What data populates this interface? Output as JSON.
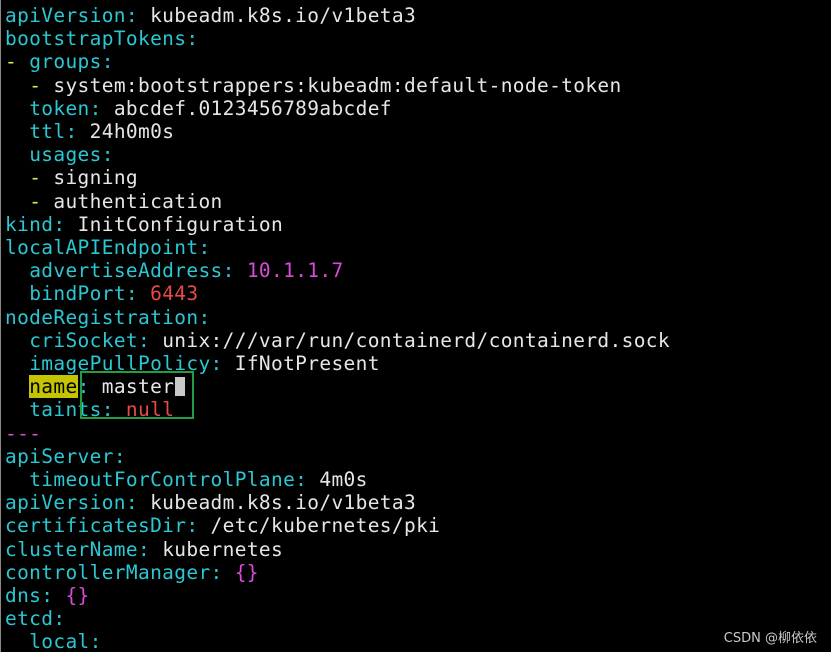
{
  "colors": {
    "background": "#000000",
    "key": "#2bc7d2",
    "list_dash": "#e8e84a",
    "value": "#e6e6e6",
    "number_value": "#d94bd9",
    "port_value": "#e84a4a",
    "search_highlight": "#c4c400",
    "selection_box": "#1f9e44"
  },
  "lines": [
    {
      "key": "apiVersion",
      "value": "kubeadm.k8s.io/v1beta3"
    },
    {
      "key": "bootstrapTokens"
    },
    {
      "dash": "- ",
      "key": "groups"
    },
    {
      "indent": "  ",
      "dash": "- ",
      "value": "system:bootstrappers:kubeadm:default-node-token"
    },
    {
      "indent": "  ",
      "key": "token",
      "value": "abcdef.0123456789abcdef"
    },
    {
      "indent": "  ",
      "key": "ttl",
      "value": "24h0m0s"
    },
    {
      "indent": "  ",
      "key": "usages"
    },
    {
      "indent": "  ",
      "dash": "- ",
      "value": "signing"
    },
    {
      "indent": "  ",
      "dash": "- ",
      "value": "authentication"
    },
    {
      "key": "kind",
      "value": "InitConfiguration"
    },
    {
      "key": "localAPIEndpoint"
    },
    {
      "indent": "  ",
      "key": "advertiseAddress",
      "value": "10.1.1.7"
    },
    {
      "indent": "  ",
      "key": "bindPort",
      "value": "6443"
    },
    {
      "key": "nodeRegistration"
    },
    {
      "indent": "  ",
      "key": "criSocket",
      "value": "unix:///var/run/containerd/containerd.sock"
    },
    {
      "indent": "  ",
      "key": "imagePullPolicy",
      "value": "IfNotPresent"
    },
    {
      "indent": "  ",
      "key": "name",
      "value": "master"
    },
    {
      "indent": "  ",
      "key": "taints",
      "value": "null"
    },
    {
      "separator": "---"
    },
    {
      "key": "apiServer"
    },
    {
      "indent": "  ",
      "key": "timeoutForControlPlane",
      "value": "4m0s"
    },
    {
      "key": "apiVersion",
      "value": "kubeadm.k8s.io/v1beta3"
    },
    {
      "key": "certificatesDir",
      "value": "/etc/kubernetes/pki"
    },
    {
      "key": "clusterName",
      "value": "kubernetes"
    },
    {
      "key": "controllerManager",
      "value": "{}"
    },
    {
      "key": "dns",
      "value": "{}"
    },
    {
      "key": "etcd"
    },
    {
      "indent": "  ",
      "key": "local"
    }
  ],
  "watermark": "CSDN @柳依依"
}
